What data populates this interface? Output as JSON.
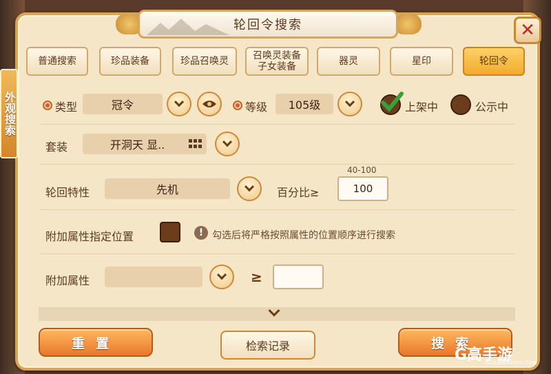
{
  "window": {
    "title": "轮回令搜索",
    "side_tag": "外观搜索"
  },
  "tabs": [
    {
      "label": "普通搜索"
    },
    {
      "label": "珍品装备"
    },
    {
      "label": "珍品召唤灵"
    },
    {
      "label": "召唤灵装备\n子女装备"
    },
    {
      "label": "器灵"
    },
    {
      "label": "星印"
    },
    {
      "label": "轮回令",
      "active": true
    }
  ],
  "form": {
    "type_label": "类型",
    "type_value": "冠令",
    "level_label": "等级",
    "level_value": "105级",
    "listed_label": "上架中",
    "public_label": "公示中",
    "suit_label": "套装",
    "suit_value": "开洞天 显..",
    "trait_label": "轮回特性",
    "trait_value": "先机",
    "percent_label": "百分比≥",
    "percent_range": "40-100",
    "percent_value": "100",
    "position_label": "附加属性指定位置",
    "position_hint": "勾选后将严格按照属性的位置顺序进行搜索",
    "attr_label": "附加属性",
    "attr_op": "≥"
  },
  "buttons": {
    "reset": "重置",
    "history": "检索记录",
    "search": "搜索",
    "close": "✕"
  },
  "watermark": {
    "brand": "G高手游",
    "url": "GAOSHOUYOU.COM"
  },
  "colors": {
    "panel": "#f5e6c7",
    "accent": "#e9782b",
    "active_tab": "#f1ac2c",
    "check": "#3aa03a"
  }
}
